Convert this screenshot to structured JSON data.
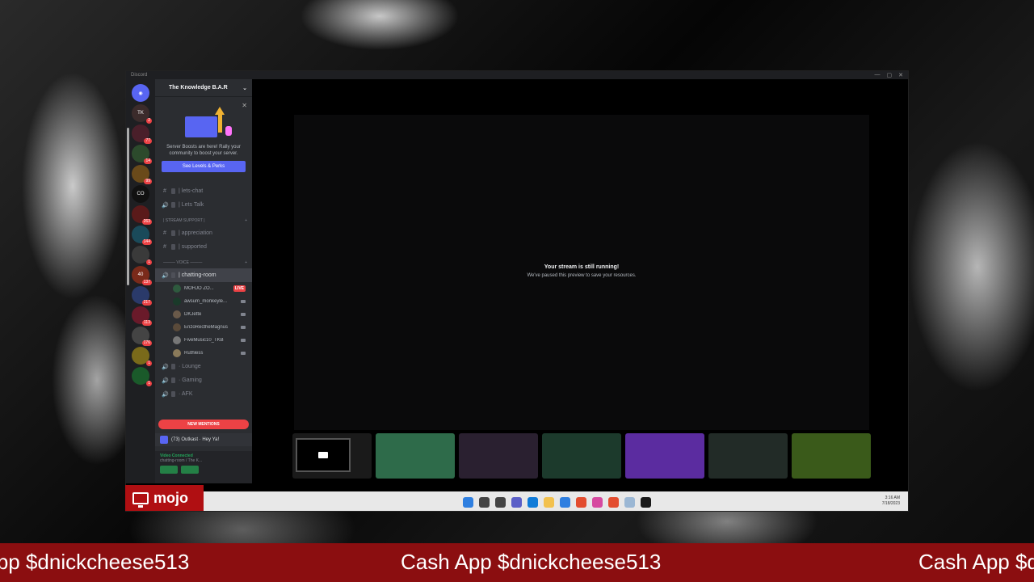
{
  "window": {
    "app_title": "Discord",
    "controls": [
      "—",
      "▢",
      "✕"
    ]
  },
  "server_rail": {
    "badges": [
      "2",
      "77",
      "14",
      "99",
      "263",
      "144",
      "1",
      "137",
      "217",
      "113",
      "176",
      "1",
      "1"
    ],
    "rail_labels": [
      "TK",
      "CO",
      "40"
    ]
  },
  "sidebar": {
    "server_name": "The Knowledge B.A.R",
    "boost": {
      "text": "Server Boosts are here! Rally your community to boost your server.",
      "button": "See Levels & Perks"
    },
    "channels_top": [
      {
        "icon": "#",
        "label": "| lets-chat"
      },
      {
        "icon": "🔊",
        "label": "| Lets Talk"
      }
    ],
    "category_stream": "| STREAM SUPPORT |",
    "stream_channels": [
      {
        "icon": "#",
        "label": "| appreciation"
      },
      {
        "icon": "#",
        "label": "| supported"
      }
    ],
    "category_voice": "——— VOICE ———",
    "active_voice": "| chatting-room",
    "voice_users": [
      {
        "name": "MOHJO ZO...",
        "live": "LIVE"
      },
      {
        "name": "awsum_monkeyle..."
      },
      {
        "name": "DKJette"
      },
      {
        "name": "EnzoRectheMagnus"
      },
      {
        "name": "FiveMusic10_TKB"
      },
      {
        "name": "Ruthless"
      }
    ],
    "channels_bottom": [
      {
        "icon": "🔊",
        "label": "· Lounge"
      },
      {
        "icon": "🔊",
        "label": "· Gaming"
      },
      {
        "icon": "🔊",
        "label": "· AFK"
      }
    ],
    "new_mentions": "NEW MENTIONS",
    "dm_preview": "(73) Outkast · Hey Ya!",
    "voice_status": "Video Connected",
    "voice_channel": "chatting-room / The K..."
  },
  "stage": {
    "paused_title": "Your stream is still running!",
    "paused_sub": "We've paused this preview to save your resources."
  },
  "tile_colors": [
    "#1a1a1a",
    "#2e6b4a",
    "#2a2030",
    "#1c3a2c",
    "#5b2ca0",
    "#222b27",
    "#3a5a1a"
  ],
  "taskbar": {
    "icon_colors": [
      "#2f7fe0",
      "#444",
      "#444",
      "#5b5fc7",
      "#0f7bd8",
      "#f2c14e",
      "#2f7fe0",
      "#e34d2f",
      "#d64aa0",
      "#e34d2f",
      "#9bb7d4",
      "#1a1a1a"
    ],
    "time": "3:16 AM",
    "date": "7/18/2023"
  },
  "mojo_label": "mojo",
  "ticker": {
    "text": "Cash App $dnickcheese513"
  },
  "colors": {
    "discord_blurple": "#5865f2",
    "live_red": "#ed4245",
    "ticker_red": "#8b0e10",
    "mojo_red": "#b00f12"
  }
}
